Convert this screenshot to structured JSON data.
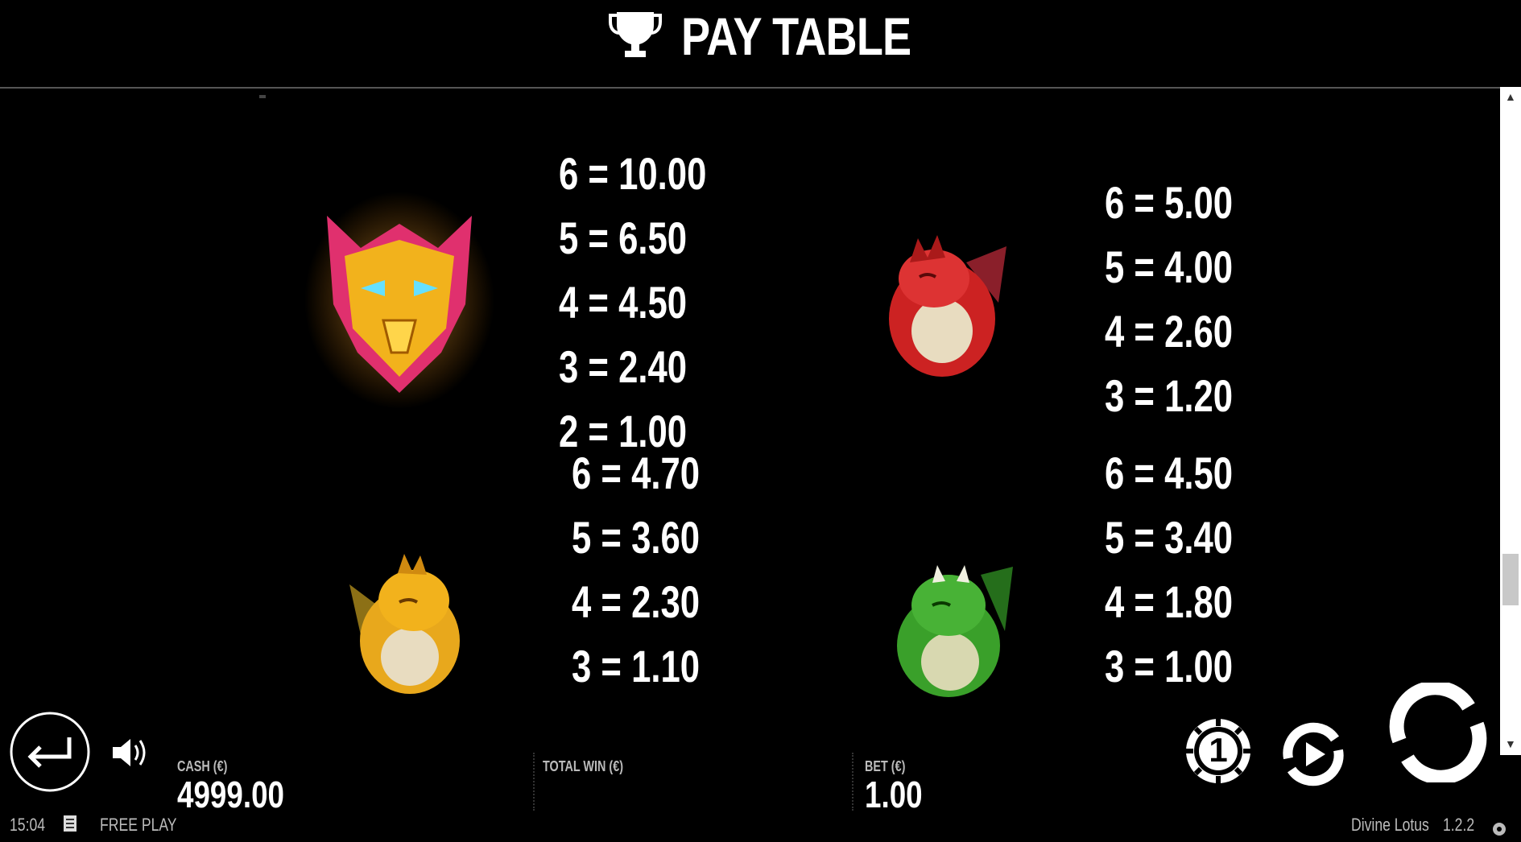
{
  "header": {
    "title": "PAY TABLE",
    "icon": "trophy-icon"
  },
  "paytable": [
    {
      "symbol": "phoenix-mask",
      "lines": [
        "6 = 10.00",
        "5 = 6.50",
        "4 = 4.50",
        "3 = 2.40",
        "2 = 1.00"
      ]
    },
    {
      "symbol": "red-dragon",
      "lines": [
        "6 = 5.00",
        "5 = 4.00",
        "4 = 2.60",
        "3 = 1.20"
      ]
    },
    {
      "symbol": "gold-dragon",
      "lines": [
        "6 = 4.70",
        "5 = 3.60",
        "4 = 2.30",
        "3 = 1.10"
      ]
    },
    {
      "symbol": "green-dragon",
      "lines": [
        "6 = 4.50",
        "5 = 3.40",
        "4 = 1.80",
        "3 = 1.00"
      ]
    }
  ],
  "hud": {
    "cash_label": "CASH (€)",
    "cash_value": "4999.00",
    "total_win_label": "TOTAL WIN (€)",
    "total_win_value": "",
    "bet_label": "BET (€)",
    "bet_value": "1.00",
    "coin_value": "1"
  },
  "footer": {
    "time": "15:04",
    "mode": "FREE PLAY",
    "game_name": "Divine Lotus",
    "version": "1.2.2"
  },
  "colors": {
    "background": "#000000",
    "text": "#ffffff",
    "muted": "#bbbbbb",
    "gold": "#f2b21c",
    "red": "#cc2222",
    "green": "#3aa02a",
    "pink": "#e0306e"
  }
}
